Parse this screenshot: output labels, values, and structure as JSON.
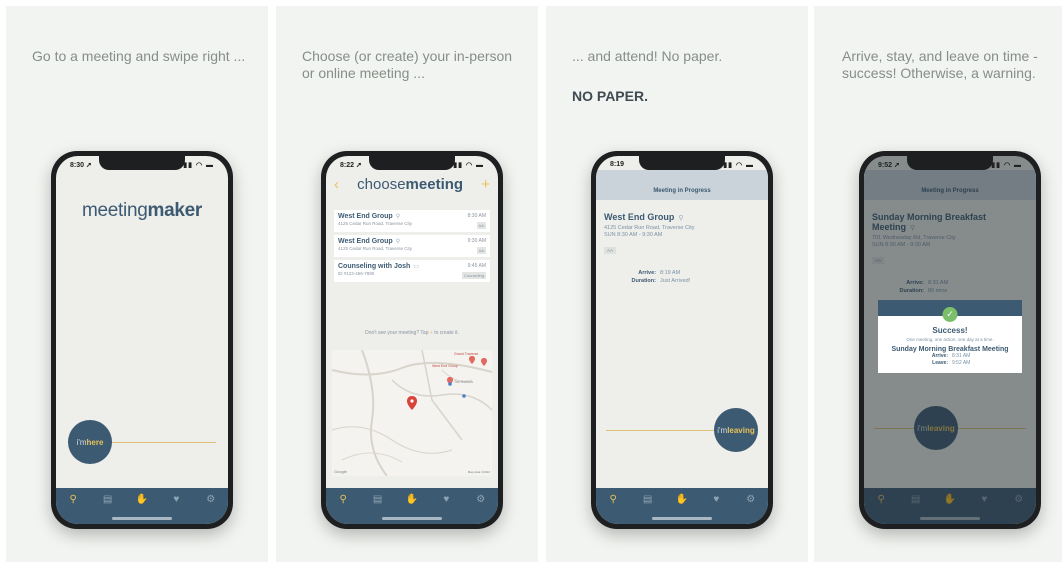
{
  "panels": [
    {
      "caption": "Go to a meeting and swipe right ...",
      "status_time": "8:30 ➚",
      "logo_light": "meeting",
      "logo_bold": "maker",
      "slider_prefix": "i'm",
      "slider_bold": "here"
    },
    {
      "caption": "Choose (or create) your in-person or online meeting ...",
      "status_time": "8:22 ➚",
      "back_icon": "‹",
      "title_light": "choose",
      "title_bold": "meeting",
      "add_icon": "+",
      "meetings": [
        {
          "name": "West End Group",
          "address": "4125 Cedar Run Road, Traverse City",
          "time": "8:30 AM",
          "tag": "AA"
        },
        {
          "name": "West End Group",
          "address": "4125 Cedar Run Road, Traverse City",
          "time": "9:30 AM",
          "tag": "AA"
        },
        {
          "name": "Counseling with Josh",
          "address": "ID #123-456-7890",
          "time": "9:45 AM",
          "tag": "Counseling"
        }
      ],
      "hint_before": "Don't see your meeting? Tap",
      "hint_plus": "+",
      "hint_after": "to create it.",
      "map_label_1": "Grand Traverse",
      "map_label_2": "West End Group",
      "map_label_3": "Tim Hortons",
      "map_label_google": "Google",
      "map_label_data": "Map data ©2022"
    },
    {
      "caption": "... and attend!  No paper.",
      "emphasis": "NO PAPER.",
      "status_time": "8:19",
      "header": "Meeting in Progress",
      "meeting_name": "West End Group",
      "address": "4125 Cedar Run Road, Traverse City",
      "when": "SUN  8:30 AM - 9:30 AM",
      "tag": "AA",
      "arrive_label": "Arrive:",
      "arrive_value": "8:19 AM",
      "duration_label": "Duration:",
      "duration_value": "Just Arrived!",
      "slider_prefix": "i'm",
      "slider_bold": "leaving"
    },
    {
      "caption": "Arrive, stay, and leave on time - success!  Otherwise, a warning.",
      "status_time": "9:52 ➚",
      "header": "Meeting in Progress",
      "meeting_name": "Sunday Morning Breakfast Meeting",
      "address": "701 Wednesday Rd, Traverse City",
      "when": "SUN  8:30 AM - 9:30 AM",
      "tag": "AA",
      "arrive_label": "Arrive:",
      "arrive_value": "8:31 AM",
      "duration_label": "Duration:",
      "duration_value": "80 mins",
      "modal_title": "Success!",
      "modal_subtitle": "One meeting, one action, one day at a time.",
      "modal_meeting": "Sunday Morning Breakfast Meeting",
      "modal_arrive_label": "Arrive:",
      "modal_arrive_value": "8:31 AM",
      "modal_leave_label": "Leave:",
      "modal_leave_value": "9:52 AM",
      "slider_prefix": "i'm",
      "slider_bold": "leaving"
    }
  ],
  "tabs": [
    "location-pin",
    "id-card",
    "handshake",
    "heart",
    "gear"
  ],
  "tab_glyphs": [
    "⚲",
    "▤",
    "✋",
    "♥",
    "⚙"
  ],
  "status_indicators": "▮▮ ◠ ▬",
  "colors": {
    "brand_blue": "#3c5a72",
    "accent_gold": "#e8c25a",
    "success_green": "#7cbf6b",
    "map_pin_red": "#d9443a"
  }
}
